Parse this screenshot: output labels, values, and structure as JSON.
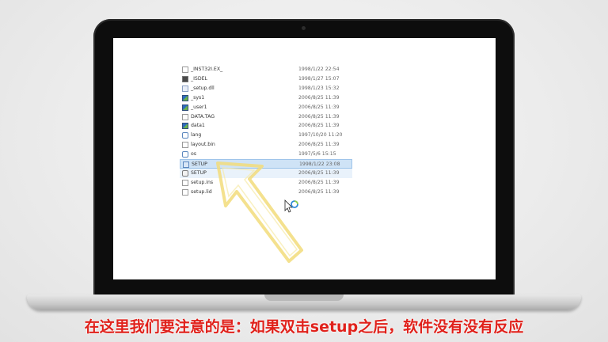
{
  "files": [
    {
      "name": "_INST32I.EX_",
      "date": "1998/1/22 22:54",
      "icon": "doc-icon",
      "state": "normal"
    },
    {
      "name": "_ISDEL",
      "date": "1998/1/27 15:07",
      "icon": "bat-icon",
      "state": "normal"
    },
    {
      "name": "_setup.dll",
      "date": "1998/1/23 15:32",
      "icon": "dll-icon",
      "state": "normal"
    },
    {
      "name": "_sys1",
      "date": "2006/8/25 11:39",
      "icon": "cab-icon",
      "state": "normal"
    },
    {
      "name": "_user1",
      "date": "2006/8/25 11:39",
      "icon": "cab-icon",
      "state": "normal"
    },
    {
      "name": "DATA.TAG",
      "date": "2006/8/25 11:39",
      "icon": "doc-icon",
      "state": "normal"
    },
    {
      "name": "data1",
      "date": "2006/8/25 11:39",
      "icon": "cab-icon",
      "state": "normal"
    },
    {
      "name": "lang",
      "date": "1997/10/20 11:20",
      "icon": "lang-icon",
      "state": "normal"
    },
    {
      "name": "layout.bin",
      "date": "2006/8/25 11:39",
      "icon": "doc-icon",
      "state": "normal"
    },
    {
      "name": "os",
      "date": "1997/5/6 15:15",
      "icon": "lang-icon",
      "state": "normal"
    },
    {
      "name": "SETUP",
      "date": "1998/1/22 23:08",
      "icon": "exe-icon",
      "state": "selected"
    },
    {
      "name": "SETUP",
      "date": "2006/8/25 11:39",
      "icon": "cfg-icon",
      "state": "hover"
    },
    {
      "name": "setup.ins",
      "date": "2006/8/25 11:39",
      "icon": "doc-icon",
      "state": "normal"
    },
    {
      "name": "setup.lid",
      "date": "2006/8/25 11:39",
      "icon": "doc-icon",
      "state": "normal"
    }
  ],
  "caption": "在这里我们要注意的是：如果双击setup之后，软件没有没有反应",
  "colors": {
    "caption": "#e0211b",
    "selection": "#cfe3f6",
    "arrow": "#f2dc7a"
  }
}
